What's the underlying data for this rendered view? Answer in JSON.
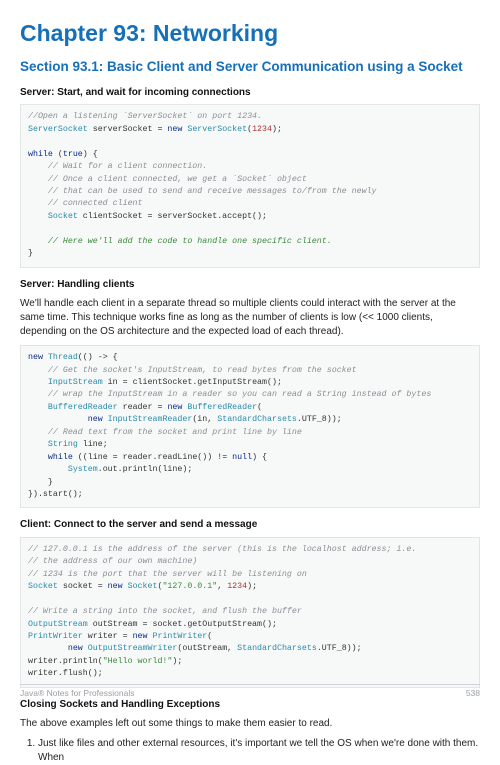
{
  "chapter_title": "Chapter 93: Networking",
  "section_title": "Section 93.1: Basic Client and Server Communication using a Socket",
  "sub1": "Server: Start, and wait for incoming connections",
  "code1": {
    "l1a": "//Open a listening `ServerSocket` on port 1234.",
    "l2_a": "ServerSocket",
    "l2_b": " serverSocket = ",
    "l2_c": "new",
    "l2_d": " ",
    "l2_e": "ServerSocket",
    "l2_f": "(",
    "l2_g": "1234",
    "l2_h": ");",
    "l4a": "while",
    "l4b": " (",
    "l4c": "true",
    "l4d": ") {",
    "l5": "    // Wait for a client connection.",
    "l6": "    // Once a client connected, we get a `Socket` object",
    "l7": "    // that can be used to send and receive messages to/from the newly",
    "l8": "    // connected client",
    "l9a": "    ",
    "l9b": "Socket",
    "l9c": " clientSocket = serverSocket.accept();",
    "l11": "    // Here we'll add the code to handle one specific client.",
    "l12": "}"
  },
  "sub2": "Server: Handling clients",
  "para2": "We'll handle each client in a separate thread so multiple clients could interact with the server at the same time. This technique works fine as long as the number of clients is low (<< 1000 clients, depending on the OS architecture and the expected load of each thread).",
  "code2": {
    "l1a": "new",
    "l1b": " ",
    "l1c": "Thread",
    "l1d": "(() -> {",
    "l2": "    // Get the socket's InputStream, to read bytes from the socket",
    "l3a": "    ",
    "l3b": "InputStream",
    "l3c": " in = clientSocket.getInputStream();",
    "l4": "    // wrap the InputStream in a reader so you can read a String instead of bytes",
    "l5a": "    ",
    "l5b": "BufferedReader",
    "l5c": " reader = ",
    "l5d": "new",
    "l5e": " ",
    "l5f": "BufferedReader",
    "l5g": "(",
    "l6a": "            ",
    "l6b": "new",
    "l6c": " ",
    "l6d": "InputStreamReader",
    "l6e": "(in, ",
    "l6f": "StandardCharsets",
    "l6g": ".UTF_8));",
    "l7": "    // Read text from the socket and print line by line",
    "l8a": "    ",
    "l8b": "String",
    "l8c": " line;",
    "l9a": "    ",
    "l9b": "while",
    "l9c": " ((line = reader.readLine()) != ",
    "l9d": "null",
    "l9e": ") {",
    "l10a": "        ",
    "l10b": "System",
    "l10c": ".out.println(line);",
    "l11": "    }",
    "l12": "}).start();"
  },
  "sub3": "Client: Connect to the server and send a message",
  "code3": {
    "l1": "// 127.0.0.1 is the address of the server (this is the localhost address; i.e.",
    "l2": "// the address of our own machine)",
    "l3": "// 1234 is the port that the server will be listening on",
    "l4a": "Socket",
    "l4b": " socket = ",
    "l4c": "new",
    "l4d": " ",
    "l4e": "Socket",
    "l4f": "(",
    "l4g": "\"127.0.0.1\"",
    "l4h": ", ",
    "l4i": "1234",
    "l4j": ");",
    "l6": "// Write a string into the socket, and flush the buffer",
    "l7a": "OutputStream",
    "l7b": " outStream = socket.getOutputStream();",
    "l8a": "PrintWriter",
    "l8b": " writer = ",
    "l8c": "new",
    "l8d": " ",
    "l8e": "PrintWriter",
    "l8f": "(",
    "l9a": "        ",
    "l9b": "new",
    "l9c": " ",
    "l9d": "OutputStreamWriter",
    "l9e": "(outStream, ",
    "l9f": "StandardCharsets",
    "l9g": ".UTF_8));",
    "l10a": "writer.println(",
    "l10b": "\"Hello world!\"",
    "l10c": ");",
    "l11": "writer.flush();"
  },
  "sub4": "Closing Sockets and Handling Exceptions",
  "para4": "The above examples left out some things to make them easier to read.",
  "list_item1": "Just like files and other external resources, it's important we tell the OS when we're done with them. When",
  "footer_left": "Java® Notes for Professionals",
  "footer_right": "538"
}
